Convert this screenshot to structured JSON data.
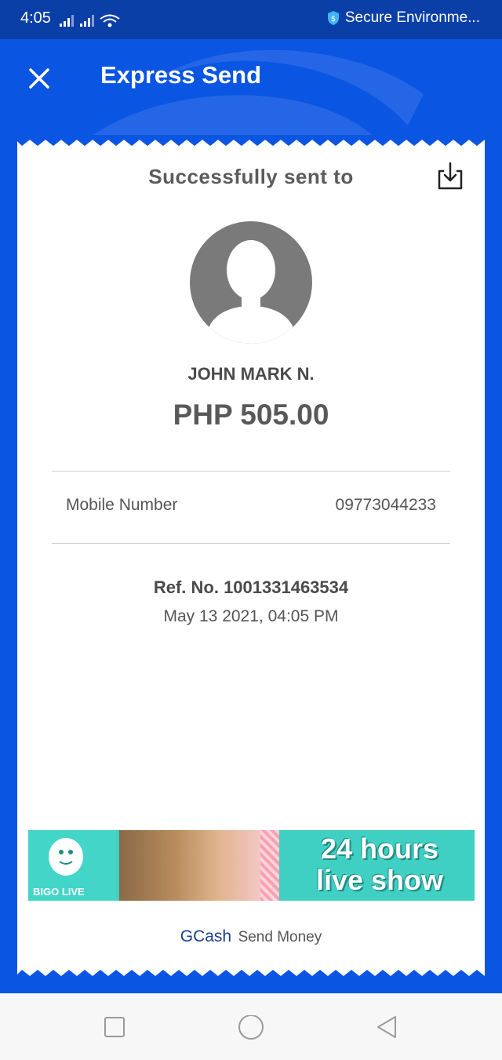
{
  "status_bar": {
    "time": "4:05",
    "secure_text": "Secure Environme..."
  },
  "header": {
    "title": "Express Send"
  },
  "receipt": {
    "success_text": "Successfully sent to",
    "recipient_name": "JOHN MARK N.",
    "amount": "PHP 505.00",
    "details": [
      {
        "label": "Mobile Number",
        "value": "09773044233"
      }
    ],
    "reference": "Ref. No. 1001331463534",
    "datetime": "May 13 2021, 04:05 PM"
  },
  "ad": {
    "brand": "BIGO LIVE",
    "line1": "24 hours",
    "line2": "live show"
  },
  "footer": {
    "brand": "GCash",
    "label": "Send Money"
  },
  "colors": {
    "primary": "#0b55e3",
    "status_bar": "#0a3fa8",
    "ad_teal": "#3fcfc3"
  }
}
